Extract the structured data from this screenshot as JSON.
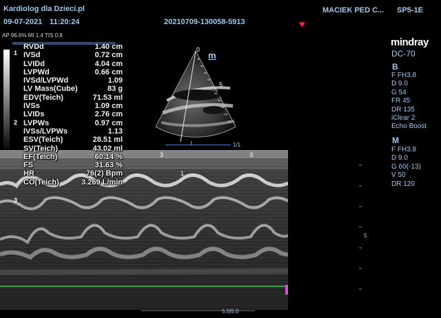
{
  "header": {
    "clinic": "Kardiolog dla Dzieci.pl",
    "date": "09-07-2021",
    "time": "11:20:24",
    "patient": "MACIEK PED C...",
    "probe": "SP5-1E",
    "exam_id": "20210709-130058-5913",
    "power_info": "AP 96.6%  MI 1.4  TIS 0.8"
  },
  "brand": {
    "logo": "mindray",
    "model": "DC-70"
  },
  "b_mode": {
    "label": "B",
    "params": [
      "F FH3.8",
      "D 9.0",
      "G 54",
      "FR 45",
      "DR 135",
      "iClear 2",
      "Echo Boost"
    ]
  },
  "m_mode": {
    "label": "M",
    "params": [
      "F FH3.8",
      "D 9.0",
      "G 60(-13)",
      "V 50",
      "DR 120"
    ]
  },
  "measurements": [
    {
      "name": "RVDd",
      "value": "1.40 cm"
    },
    {
      "name": "IVSd",
      "value": "0.72 cm"
    },
    {
      "name": "LVIDd",
      "value": "4.04 cm"
    },
    {
      "name": "LVPWd",
      "value": "0.66 cm"
    },
    {
      "name": "IVSd/LVPWd",
      "value": "1.09"
    },
    {
      "name": "LV Mass(Cube)",
      "value": "83 g"
    },
    {
      "name": "EDV(Teich)",
      "value": "71.53 ml"
    },
    {
      "name": "IVSs",
      "value": "1.09 cm"
    },
    {
      "name": "LVIDs",
      "value": "2.76 cm"
    },
    {
      "name": "LVPWs",
      "value": "0.97 cm"
    },
    {
      "name": "IVSs/LVPWs",
      "value": "1.13"
    },
    {
      "name": "ESV(Teich)",
      "value": "28.51 ml"
    },
    {
      "name": "SV(Teich)",
      "value": "43.02 ml"
    },
    {
      "name": "EF(Teich)",
      "value": "60.14 %"
    },
    {
      "name": "FS",
      "value": "31.63 %"
    },
    {
      "name": "HR",
      "value": "76(2) Bpm"
    },
    {
      "name": "CO(Teich)",
      "value": "3.269 L/min"
    }
  ],
  "meas_groups": [
    "1",
    "2",
    "3"
  ],
  "sector": {
    "m_label": "m",
    "depth0": "0",
    "depth5": "5",
    "ratio": "1/1"
  },
  "mmode_markers": {
    "mark_a": "3",
    "mark_b": "3",
    "mark_inner": "1"
  },
  "scale": {
    "right_tick": "5",
    "bottom_sweep": "5.0|5.0"
  },
  "colors": {
    "accent": "#9fc9f0",
    "heart": "#ff1e3a",
    "ecg": "#2bd24a"
  }
}
